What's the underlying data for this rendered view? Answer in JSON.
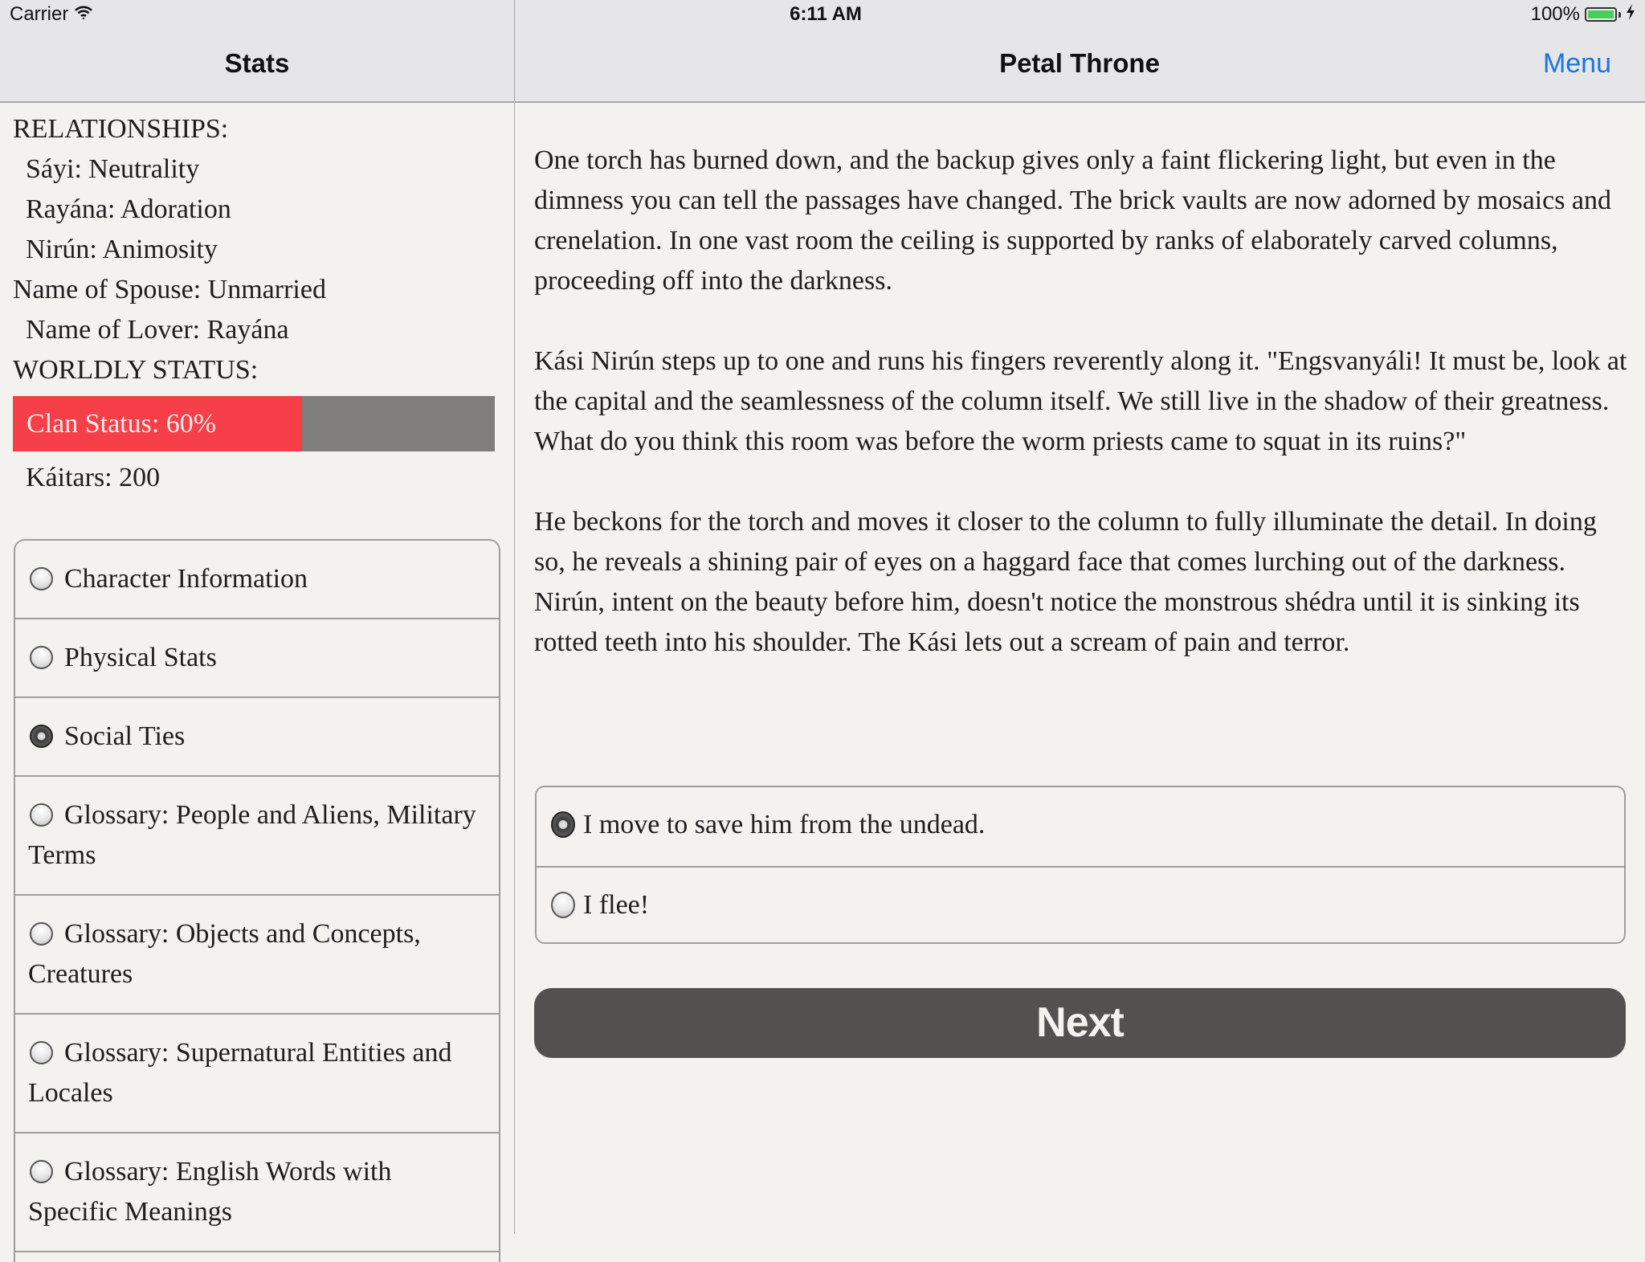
{
  "status_bar": {
    "carrier": "Carrier",
    "wifi_icon": "wifi-icon",
    "time": "6:11 AM",
    "battery_percent": "100%",
    "battery_level": 1.0,
    "battery_color": "#44d05a",
    "charging_icon": "bolt-icon"
  },
  "nav": {
    "left_title": "Stats",
    "right_title": "Petal Throne",
    "menu_label": "Menu",
    "accent_color": "#1a73e8"
  },
  "stats": {
    "relationships_heading": "RELATIONSHIPS:",
    "relationships": [
      "Sáyi: Neutrality",
      "Rayána: Adoration",
      "Nirún: Animosity"
    ],
    "spouse": "Name of Spouse: Unmarried",
    "lover": "Name of Lover: Rayána",
    "worldly_heading": "WORLDLY STATUS:",
    "clan_status": {
      "label": "Clan Status: 60%",
      "value_percent": 60,
      "fill_color": "#f63f48",
      "track_color": "#7f7e7c"
    },
    "kaitars": "Káitars: 200"
  },
  "stat_menu": {
    "items": [
      {
        "label": "Character Information",
        "selected": false
      },
      {
        "label": "Physical Stats",
        "selected": false
      },
      {
        "label": "Social Ties",
        "selected": true
      },
      {
        "label": "Glossary: People and Aliens, Military Terms",
        "selected": false
      },
      {
        "label": "Glossary: Objects and Concepts, Creatures",
        "selected": false
      },
      {
        "label": "Glossary: Supernatural Entities and Locales",
        "selected": false
      },
      {
        "label": "Glossary: English Words with Specific Meanings",
        "selected": false
      }
    ]
  },
  "story": {
    "paragraphs": [
      "One torch has burned down, and the backup gives only a faint flickering light, but even in the dimness you can tell the passages have changed. The brick vaults are now adorned by mosaics and crenelation. In one vast room the ceiling is supported by ranks of elaborately carved columns, proceeding off into the darkness.",
      "Kási Nirún steps up to one and runs his fingers reverently along it. \"Engsvanyáli! It must be, look at the capital and the seamlessness of the column itself. We still live in the shadow of their greatness. What do you think this room was before the worm priests came to squat in its ruins?\"",
      "He beckons for the torch and moves it closer to the column to fully illuminate the detail. In doing so, he reveals a shining pair of eyes on a haggard face that comes lurching out of the darkness. Nirún, intent on the beauty before him, doesn't notice the monstrous shédra until it is sinking its rotted teeth into his shoulder. The Kási lets out a scream of pain and terror."
    ],
    "choices": [
      {
        "label": "I move to save him from the undead.",
        "selected": true
      },
      {
        "label": "I flee!",
        "selected": false
      }
    ],
    "next_label": "Next"
  }
}
